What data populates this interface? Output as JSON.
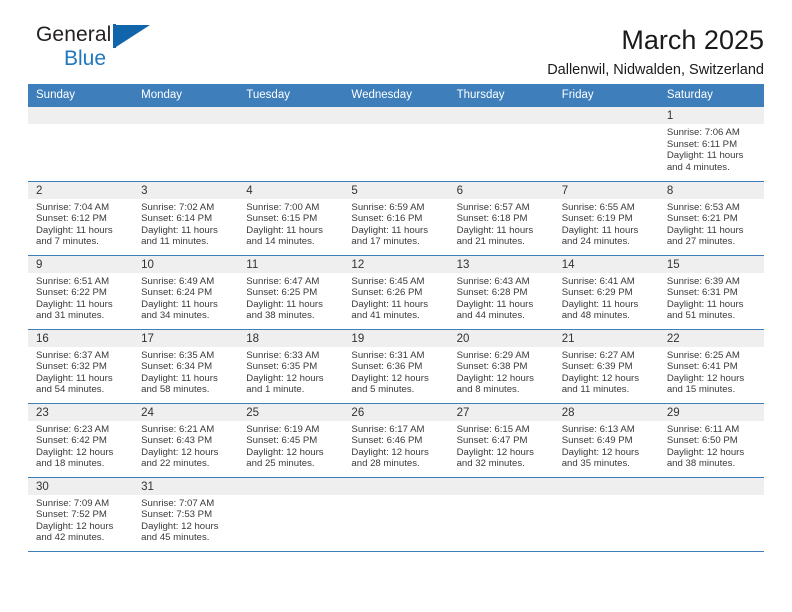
{
  "brand": {
    "name_top": "General",
    "name_bottom": "Blue",
    "accent_color": "#1166ab"
  },
  "header": {
    "title": "March 2025",
    "subtitle": "Dallenwil, Nidwalden, Switzerland"
  },
  "theme": {
    "header_blue": "#3d7ebb",
    "daynum_gray": "#efefef",
    "text": "#3a3a3a"
  },
  "weekday_headers": [
    "Sunday",
    "Monday",
    "Tuesday",
    "Wednesday",
    "Thursday",
    "Friday",
    "Saturday"
  ],
  "weeks": [
    [
      {
        "day": "",
        "empty": true
      },
      {
        "day": "",
        "empty": true
      },
      {
        "day": "",
        "empty": true
      },
      {
        "day": "",
        "empty": true
      },
      {
        "day": "",
        "empty": true
      },
      {
        "day": "",
        "empty": true
      },
      {
        "day": "1",
        "sunrise": "Sunrise: 7:06 AM",
        "sunset": "Sunset: 6:11 PM",
        "daylight": "Daylight: 11 hours and 4 minutes."
      }
    ],
    [
      {
        "day": "2",
        "sunrise": "Sunrise: 7:04 AM",
        "sunset": "Sunset: 6:12 PM",
        "daylight": "Daylight: 11 hours and 7 minutes."
      },
      {
        "day": "3",
        "sunrise": "Sunrise: 7:02 AM",
        "sunset": "Sunset: 6:14 PM",
        "daylight": "Daylight: 11 hours and 11 minutes."
      },
      {
        "day": "4",
        "sunrise": "Sunrise: 7:00 AM",
        "sunset": "Sunset: 6:15 PM",
        "daylight": "Daylight: 11 hours and 14 minutes."
      },
      {
        "day": "5",
        "sunrise": "Sunrise: 6:59 AM",
        "sunset": "Sunset: 6:16 PM",
        "daylight": "Daylight: 11 hours and 17 minutes."
      },
      {
        "day": "6",
        "sunrise": "Sunrise: 6:57 AM",
        "sunset": "Sunset: 6:18 PM",
        "daylight": "Daylight: 11 hours and 21 minutes."
      },
      {
        "day": "7",
        "sunrise": "Sunrise: 6:55 AM",
        "sunset": "Sunset: 6:19 PM",
        "daylight": "Daylight: 11 hours and 24 minutes."
      },
      {
        "day": "8",
        "sunrise": "Sunrise: 6:53 AM",
        "sunset": "Sunset: 6:21 PM",
        "daylight": "Daylight: 11 hours and 27 minutes."
      }
    ],
    [
      {
        "day": "9",
        "sunrise": "Sunrise: 6:51 AM",
        "sunset": "Sunset: 6:22 PM",
        "daylight": "Daylight: 11 hours and 31 minutes."
      },
      {
        "day": "10",
        "sunrise": "Sunrise: 6:49 AM",
        "sunset": "Sunset: 6:24 PM",
        "daylight": "Daylight: 11 hours and 34 minutes."
      },
      {
        "day": "11",
        "sunrise": "Sunrise: 6:47 AM",
        "sunset": "Sunset: 6:25 PM",
        "daylight": "Daylight: 11 hours and 38 minutes."
      },
      {
        "day": "12",
        "sunrise": "Sunrise: 6:45 AM",
        "sunset": "Sunset: 6:26 PM",
        "daylight": "Daylight: 11 hours and 41 minutes."
      },
      {
        "day": "13",
        "sunrise": "Sunrise: 6:43 AM",
        "sunset": "Sunset: 6:28 PM",
        "daylight": "Daylight: 11 hours and 44 minutes."
      },
      {
        "day": "14",
        "sunrise": "Sunrise: 6:41 AM",
        "sunset": "Sunset: 6:29 PM",
        "daylight": "Daylight: 11 hours and 48 minutes."
      },
      {
        "day": "15",
        "sunrise": "Sunrise: 6:39 AM",
        "sunset": "Sunset: 6:31 PM",
        "daylight": "Daylight: 11 hours and 51 minutes."
      }
    ],
    [
      {
        "day": "16",
        "sunrise": "Sunrise: 6:37 AM",
        "sunset": "Sunset: 6:32 PM",
        "daylight": "Daylight: 11 hours and 54 minutes."
      },
      {
        "day": "17",
        "sunrise": "Sunrise: 6:35 AM",
        "sunset": "Sunset: 6:34 PM",
        "daylight": "Daylight: 11 hours and 58 minutes."
      },
      {
        "day": "18",
        "sunrise": "Sunrise: 6:33 AM",
        "sunset": "Sunset: 6:35 PM",
        "daylight": "Daylight: 12 hours and 1 minute."
      },
      {
        "day": "19",
        "sunrise": "Sunrise: 6:31 AM",
        "sunset": "Sunset: 6:36 PM",
        "daylight": "Daylight: 12 hours and 5 minutes."
      },
      {
        "day": "20",
        "sunrise": "Sunrise: 6:29 AM",
        "sunset": "Sunset: 6:38 PM",
        "daylight": "Daylight: 12 hours and 8 minutes."
      },
      {
        "day": "21",
        "sunrise": "Sunrise: 6:27 AM",
        "sunset": "Sunset: 6:39 PM",
        "daylight": "Daylight: 12 hours and 11 minutes."
      },
      {
        "day": "22",
        "sunrise": "Sunrise: 6:25 AM",
        "sunset": "Sunset: 6:41 PM",
        "daylight": "Daylight: 12 hours and 15 minutes."
      }
    ],
    [
      {
        "day": "23",
        "sunrise": "Sunrise: 6:23 AM",
        "sunset": "Sunset: 6:42 PM",
        "daylight": "Daylight: 12 hours and 18 minutes."
      },
      {
        "day": "24",
        "sunrise": "Sunrise: 6:21 AM",
        "sunset": "Sunset: 6:43 PM",
        "daylight": "Daylight: 12 hours and 22 minutes."
      },
      {
        "day": "25",
        "sunrise": "Sunrise: 6:19 AM",
        "sunset": "Sunset: 6:45 PM",
        "daylight": "Daylight: 12 hours and 25 minutes."
      },
      {
        "day": "26",
        "sunrise": "Sunrise: 6:17 AM",
        "sunset": "Sunset: 6:46 PM",
        "daylight": "Daylight: 12 hours and 28 minutes."
      },
      {
        "day": "27",
        "sunrise": "Sunrise: 6:15 AM",
        "sunset": "Sunset: 6:47 PM",
        "daylight": "Daylight: 12 hours and 32 minutes."
      },
      {
        "day": "28",
        "sunrise": "Sunrise: 6:13 AM",
        "sunset": "Sunset: 6:49 PM",
        "daylight": "Daylight: 12 hours and 35 minutes."
      },
      {
        "day": "29",
        "sunrise": "Sunrise: 6:11 AM",
        "sunset": "Sunset: 6:50 PM",
        "daylight": "Daylight: 12 hours and 38 minutes."
      }
    ],
    [
      {
        "day": "30",
        "sunrise": "Sunrise: 7:09 AM",
        "sunset": "Sunset: 7:52 PM",
        "daylight": "Daylight: 12 hours and 42 minutes."
      },
      {
        "day": "31",
        "sunrise": "Sunrise: 7:07 AM",
        "sunset": "Sunset: 7:53 PM",
        "daylight": "Daylight: 12 hours and 45 minutes."
      },
      {
        "day": "",
        "empty": true
      },
      {
        "day": "",
        "empty": true
      },
      {
        "day": "",
        "empty": true
      },
      {
        "day": "",
        "empty": true
      },
      {
        "day": "",
        "empty": true
      }
    ]
  ]
}
